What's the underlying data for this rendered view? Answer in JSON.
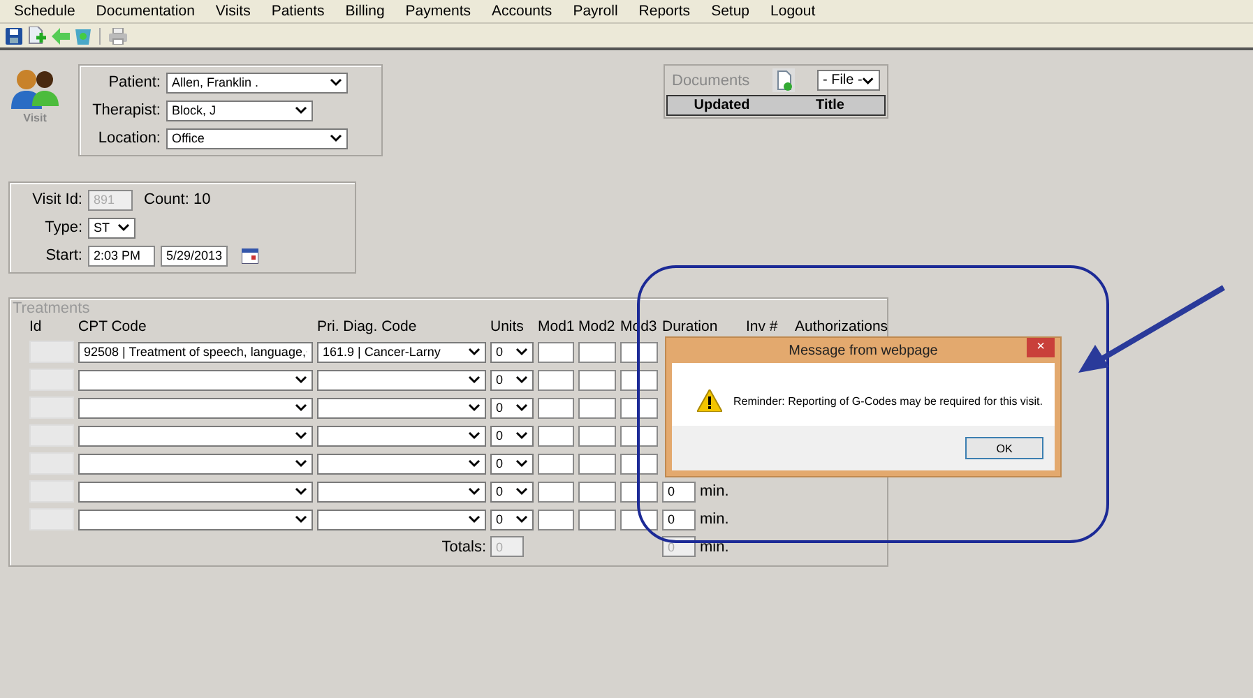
{
  "menu": [
    "Schedule",
    "Documentation",
    "Visits",
    "Patients",
    "Billing",
    "Payments",
    "Accounts",
    "Payroll",
    "Reports",
    "Setup",
    "Logout"
  ],
  "toolbar": [
    {
      "kind": "save"
    },
    {
      "kind": "new"
    },
    {
      "kind": "back"
    },
    {
      "kind": "delete"
    },
    {
      "kind": "separator"
    },
    {
      "kind": "print"
    }
  ],
  "visit_icon": {
    "label": "Visit"
  },
  "patient_panel": {
    "fields": [
      {
        "label": "Patient:",
        "value": "Allen, Franklin ."
      },
      {
        "label": "Therapist:",
        "value": "Block, J"
      },
      {
        "label": "Location:",
        "value": "Office"
      }
    ]
  },
  "documents": {
    "title": "Documents",
    "file_select": "- File -",
    "columns": [
      "Updated",
      "Title"
    ]
  },
  "visit_panel": {
    "visit_id_label": "Visit Id:",
    "visit_id": "891",
    "count": "Count: 10",
    "type_label": "Type:",
    "type": "ST",
    "start_label": "Start:",
    "start_time": "2:03 PM",
    "start_date": "5/29/2013"
  },
  "treatments": {
    "title": "Treatments",
    "columns": [
      "Id",
      "CPT Code",
      "Pri. Diag. Code",
      "Units",
      "Mod1",
      "Mod2",
      "Mod3",
      "Duration",
      "Inv #",
      "Authorizations"
    ],
    "rows": [
      {
        "cpt": "92508 | Treatment of speech, language,",
        "diag": "161.9 | Cancer-Larny",
        "units": "0"
      },
      {
        "units": "0"
      },
      {
        "units": "0"
      },
      {
        "units": "0"
      },
      {
        "units": "0"
      },
      {
        "units": "0",
        "duration": "0",
        "duration_unit": "min."
      },
      {
        "units": "0",
        "duration": "0",
        "duration_unit": "min."
      }
    ],
    "totals_label": "Totals:",
    "totals_units": "0",
    "totals_duration": "0",
    "totals_unit": "min."
  },
  "dialog": {
    "title": "Message from webpage",
    "close": "×",
    "message": "Reminder: Reporting of G-Codes may be required for this visit.",
    "button": "OK"
  }
}
